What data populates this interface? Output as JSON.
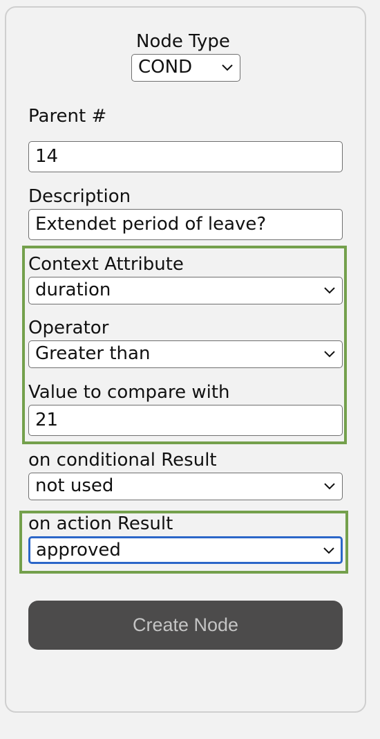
{
  "node_type": {
    "label": "Node Type",
    "selected": "COND"
  },
  "parent": {
    "label": "Parent #",
    "value": "14"
  },
  "description": {
    "label": "Description",
    "value": "Extendet period of leave?"
  },
  "condition_group": {
    "context_attribute": {
      "label": "Context Attribute",
      "selected": "duration"
    },
    "operator": {
      "label": "Operator",
      "selected": "Greater than"
    },
    "compare_value": {
      "label": "Value to compare with",
      "value": "21"
    }
  },
  "on_conditional_result": {
    "label": "on conditional Result",
    "selected": "not used"
  },
  "on_action_result": {
    "label": "on action Result",
    "selected": "approved"
  },
  "create_button": {
    "label": "Create Node"
  },
  "colors": {
    "group_border": "#74a04c",
    "focus_ring": "#2b66c8",
    "button_bg": "#4c4b4b",
    "button_text": "#c4c4c4"
  },
  "icons": {
    "dropdown": "chevron-down-icon"
  }
}
